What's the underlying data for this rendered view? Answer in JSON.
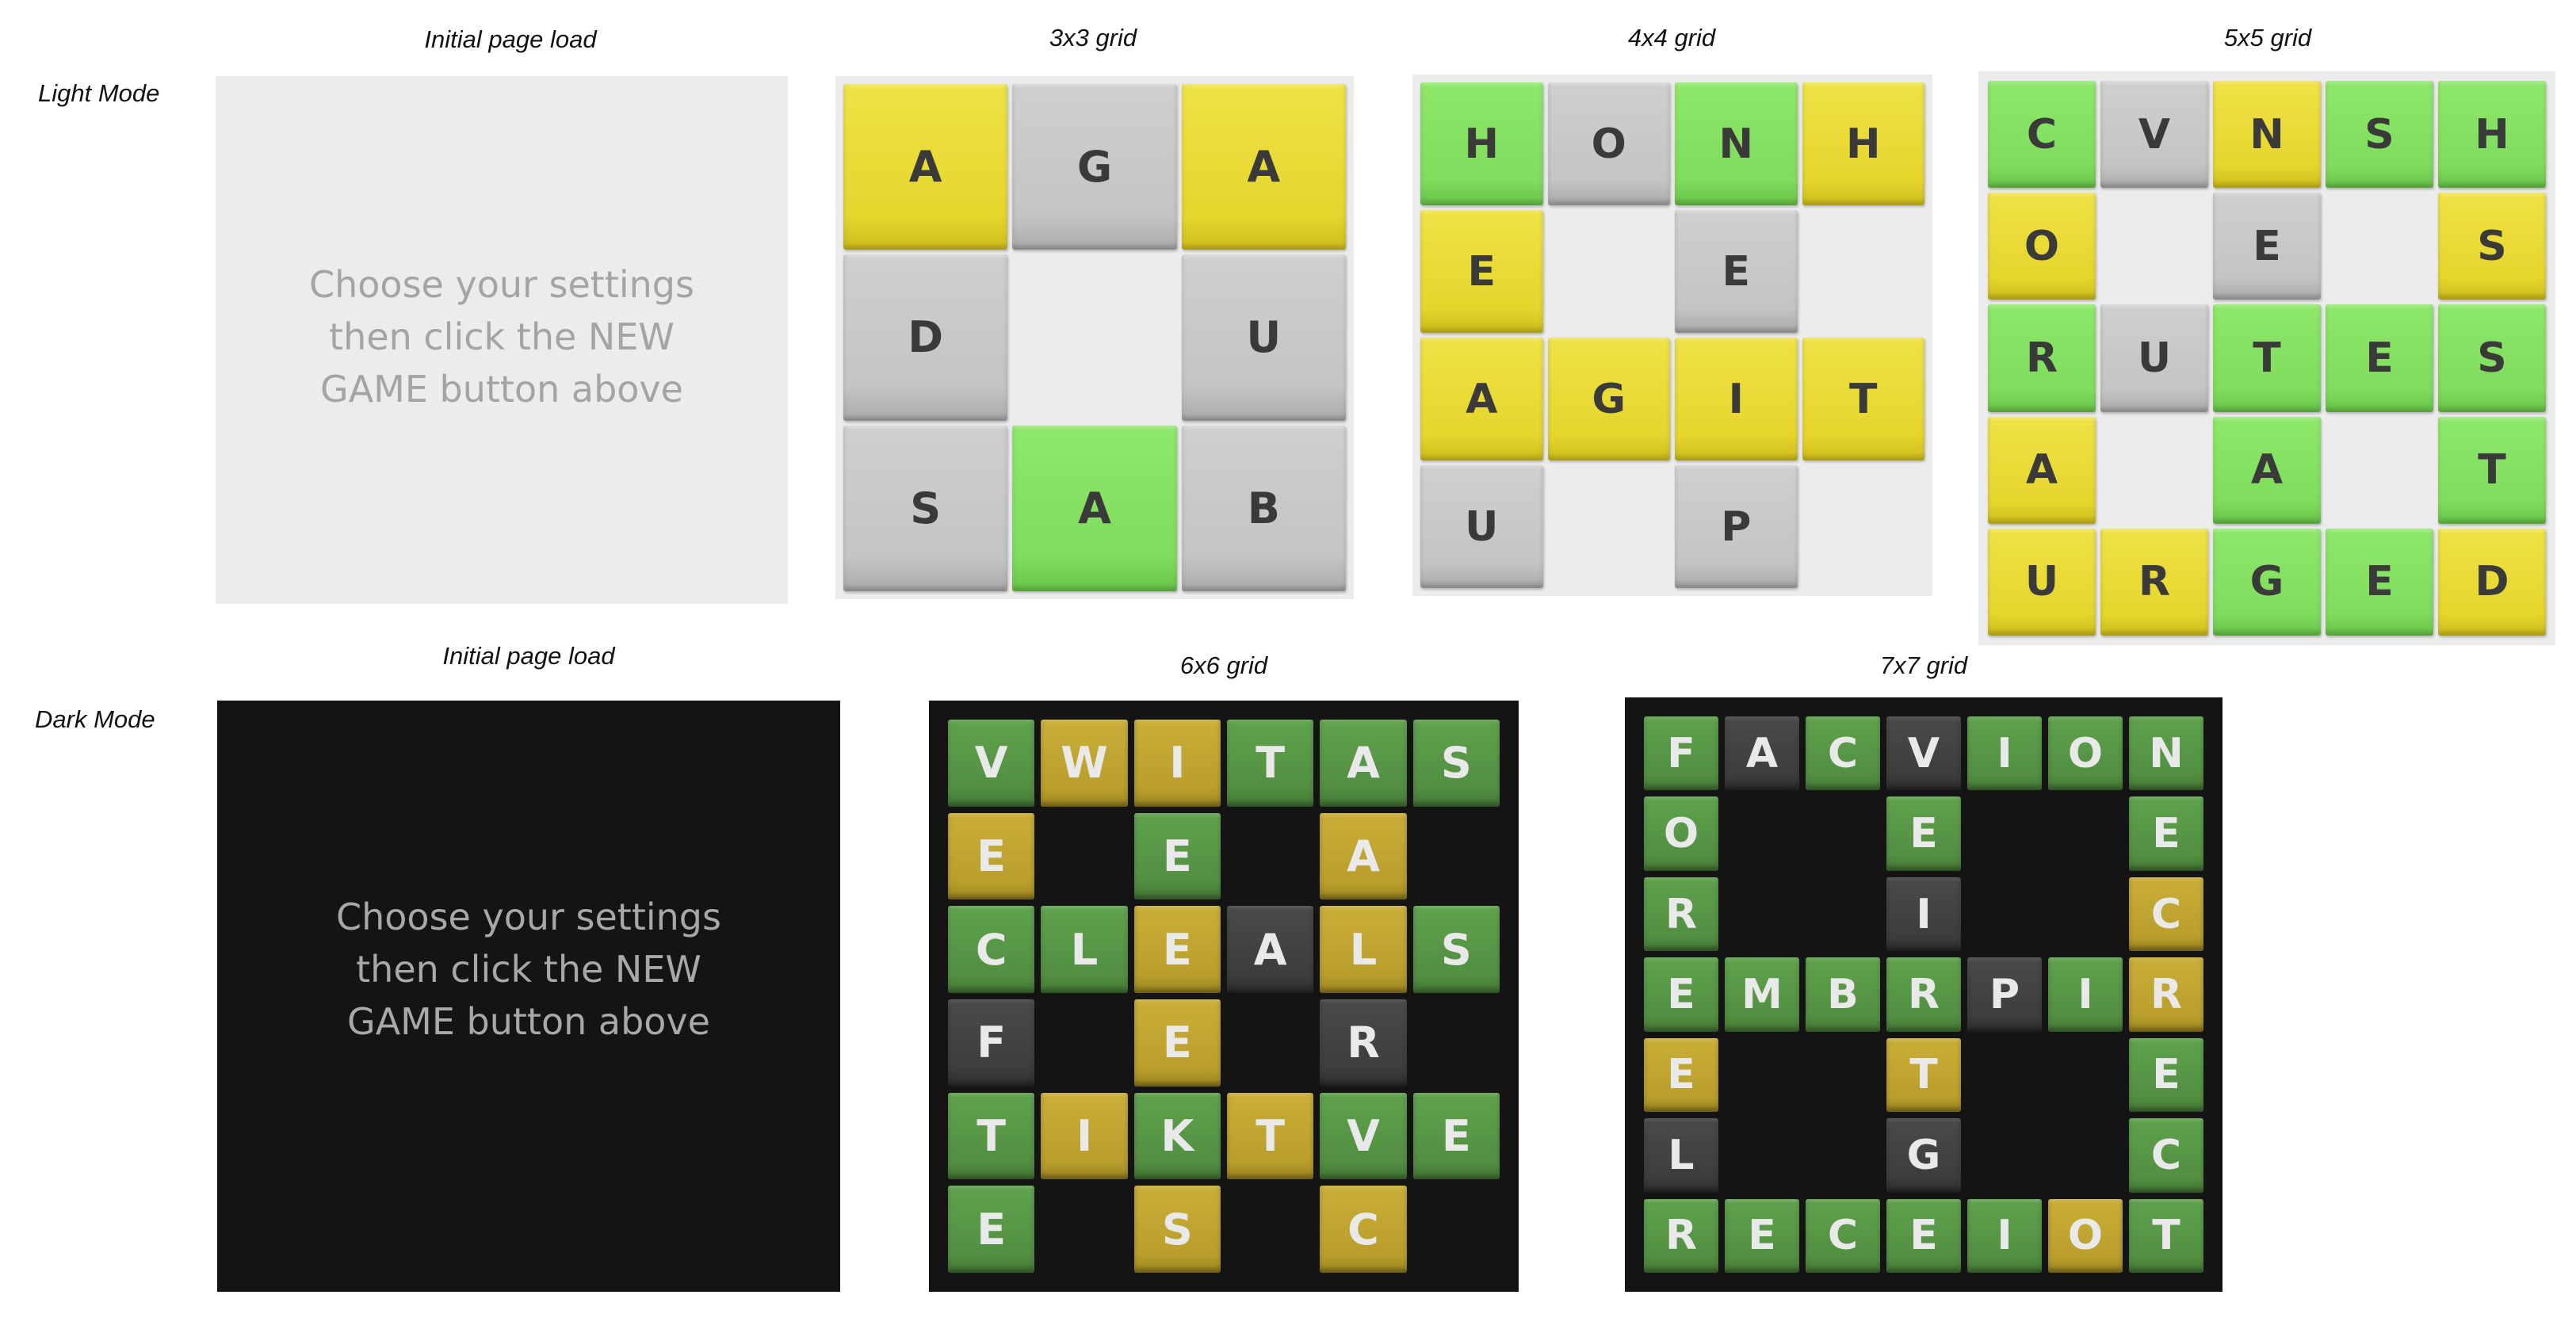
{
  "row_labels": {
    "light": "Light Mode",
    "dark": "Dark Mode"
  },
  "colors": {
    "light_panel_bg": "#ececec",
    "dark_panel_bg": "#141414",
    "light_yellow": "#e6d52c",
    "light_green": "#7fdc5c",
    "light_gray": "#c4c4c4",
    "dark_yellow": "#b99e2c",
    "dark_green": "#528f41",
    "dark_gray": "#3d3d3d"
  },
  "light": {
    "initial": {
      "caption": "Initial page load",
      "message": [
        "Choose your settings",
        "then click the NEW",
        "GAME button above"
      ]
    },
    "grids": [
      {
        "caption": "3x3 grid",
        "size": 3,
        "rows": [
          [
            "A:y",
            "G:g",
            "A:y"
          ],
          [
            "D:g",
            "",
            "U:g"
          ],
          [
            "S:g",
            "A:G",
            "B:g"
          ]
        ]
      },
      {
        "caption": "4x4 grid",
        "size": 4,
        "rows": [
          [
            "H:G",
            "O:g",
            "N:G",
            "H:y"
          ],
          [
            "E:y",
            "",
            "E:g",
            ""
          ],
          [
            "A:y",
            "G:y",
            "I:y",
            "T:y"
          ],
          [
            "U:g",
            "",
            "P:g",
            ""
          ]
        ]
      },
      {
        "caption": "5x5 grid",
        "size": 5,
        "rows": [
          [
            "C:G",
            "V:g",
            "N:y",
            "S:G",
            "H:G"
          ],
          [
            "O:y",
            "",
            "E:g",
            "",
            "S:y"
          ],
          [
            "R:G",
            "U:g",
            "T:G",
            "E:G",
            "S:G"
          ],
          [
            "A:y",
            "",
            "A:G",
            "",
            "T:G"
          ],
          [
            "U:y",
            "R:y",
            "G:G",
            "E:G",
            "D:y"
          ]
        ]
      }
    ]
  },
  "dark": {
    "initial": {
      "caption": "Initial page load",
      "message": [
        "Choose your settings",
        "then click the NEW",
        "GAME button above"
      ]
    },
    "grids": [
      {
        "caption": "6x6 grid",
        "size": 6,
        "rows": [
          [
            "V:G",
            "W:y",
            "I:y",
            "T:G",
            "A:G",
            "S:G"
          ],
          [
            "E:y",
            "",
            "E:G",
            "",
            "A:y",
            ""
          ],
          [
            "C:G",
            "L:G",
            "E:y",
            "A:g",
            "L:y",
            "S:G"
          ],
          [
            "F:g",
            "",
            "E:y",
            "",
            "R:g",
            ""
          ],
          [
            "T:G",
            "I:y",
            "K:G",
            "T:y",
            "V:G",
            "E:G"
          ],
          [
            "E:G",
            "",
            "S:y",
            "",
            "C:y",
            ""
          ]
        ]
      },
      {
        "caption": "7x7 grid",
        "size": 7,
        "rows": [
          [
            "F:G",
            "A:g",
            "C:G",
            "V:g",
            "I:G",
            "O:G",
            "N:G"
          ],
          [
            "O:G",
            "",
            "",
            "E:G",
            "",
            "",
            "E:G"
          ],
          [
            "R:G",
            "",
            "",
            "I:g",
            "",
            "",
            "C:y"
          ],
          [
            "E:G",
            "M:G",
            "B:G",
            "R:G",
            "P:g",
            "I:G",
            "R:y"
          ],
          [
            "E:y",
            "",
            "",
            "T:y",
            "",
            "",
            "E:G"
          ],
          [
            "L:g",
            "",
            "",
            "G:g",
            "",
            "",
            "C:G"
          ],
          [
            "R:G",
            "E:G",
            "C:G",
            "E:G",
            "I:G",
            "O:y",
            "T:G"
          ]
        ]
      }
    ]
  }
}
